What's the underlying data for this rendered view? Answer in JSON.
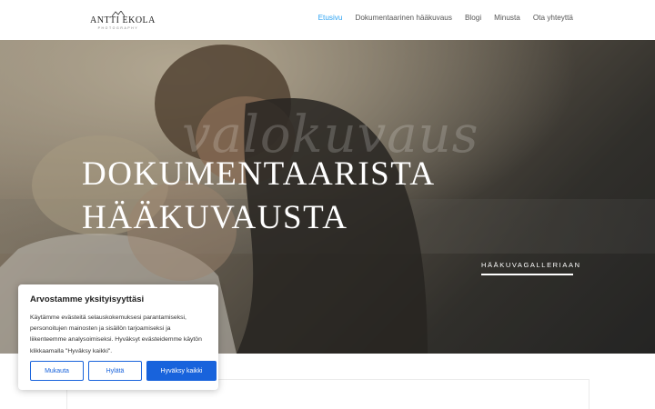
{
  "header": {
    "logo": {
      "name": "ANTTI EKOLA",
      "sub": "PHOTOGRAPHY"
    },
    "nav": [
      {
        "label": "Etusivu",
        "active": true
      },
      {
        "label": "Dokumentaarinen hääkuvaus",
        "active": false
      },
      {
        "label": "Blogi",
        "active": false
      },
      {
        "label": "Minusta",
        "active": false
      },
      {
        "label": "Ota yhteyttä",
        "active": false
      }
    ]
  },
  "hero": {
    "script_word": "valokuvaus",
    "title_line1": "DOKUMENTAARISTA",
    "title_line2": "HÄÄKUVAUSTA",
    "gallery_button": "HÄÄKUVAGALLERIAAN"
  },
  "cookie": {
    "title": "Arvostamme yksityisyyttäsi",
    "text": "Käytämme evästeitä selauskokemuksesi parantamiseksi, personoitujen mainosten ja sisällön tarjoamiseksi ja liikenteemme analysoimiseksi. Hyväksyt evästeidemme käytön klikkaamalla \"Hyväksy kaikki\".",
    "customize": "Mukauta",
    "reject": "Hylätä",
    "accept_all": "Hyväksy kaikki"
  },
  "colors": {
    "accent": "#2ea3f2",
    "cookie_blue": "#1863dc"
  }
}
